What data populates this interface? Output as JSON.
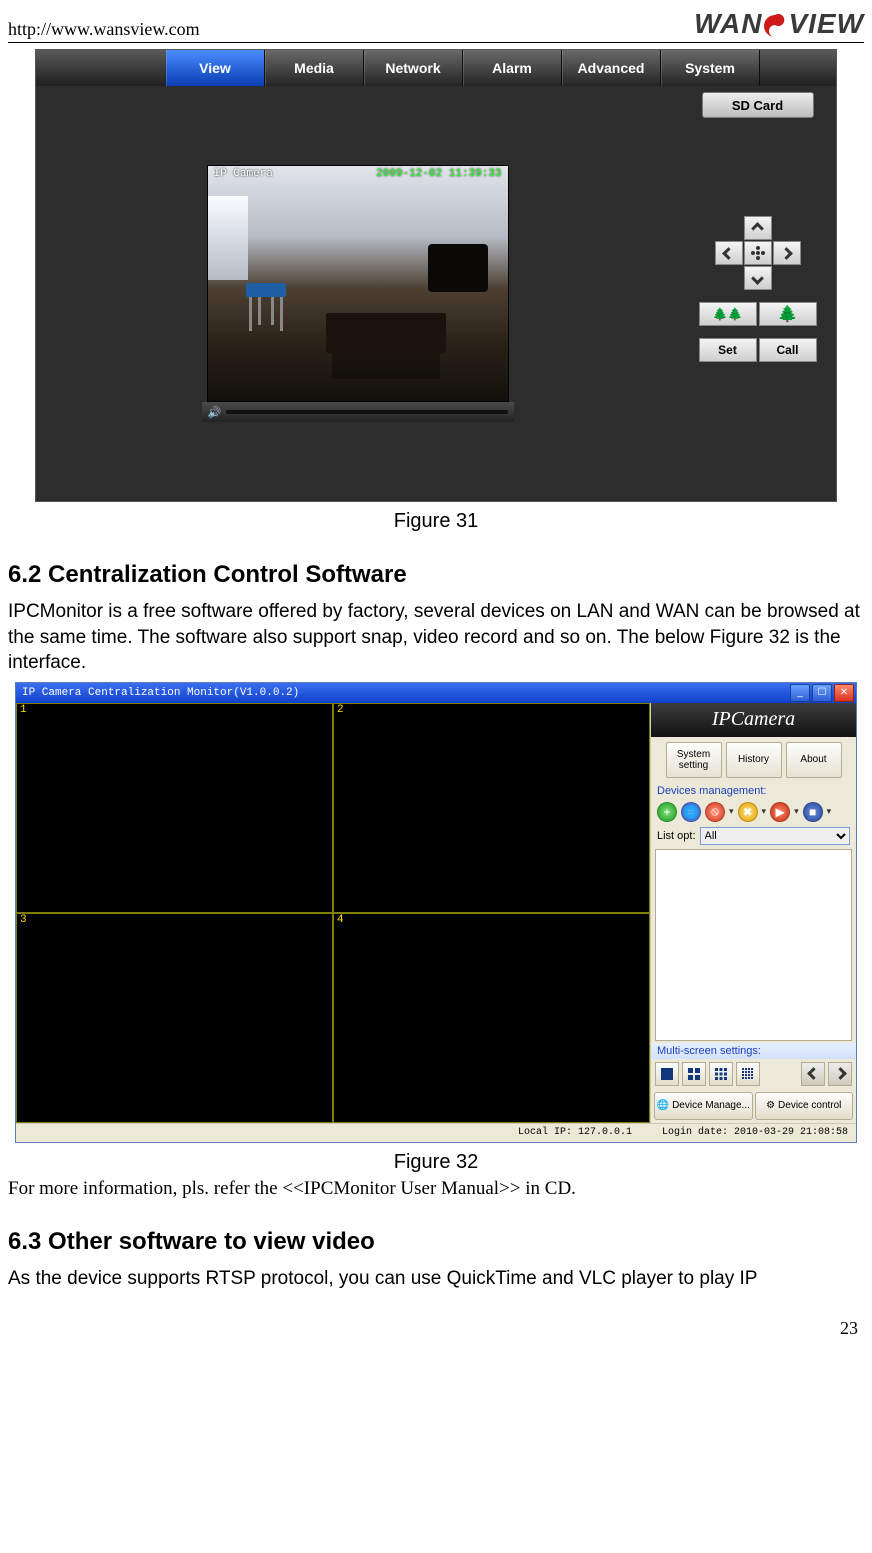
{
  "header": {
    "url": "http://www.wansview.com",
    "logo_pre": "WAN",
    "logo_s": "S",
    "logo_post": "VIEW"
  },
  "fig31": {
    "tabs": [
      "View",
      "Media",
      "Network",
      "Alarm",
      "Advanced",
      "System"
    ],
    "sd_button": "SD Card",
    "osd_name": "IP Camera",
    "osd_time": "2009-12-02 11:39:33",
    "set": "Set",
    "call": "Call",
    "caption": "Figure 31"
  },
  "sec62": {
    "heading": "6.2  Centralization Control Software",
    "para": "IPCMonitor is a free software offered by factory, several devices on LAN and WAN can be browsed at the same time. The software also support snap, video record and so on. The below Figure 32 is the interface."
  },
  "fig32": {
    "title": "IP Camera Centralization Monitor(V1.0.0.2)",
    "side_logo": "IPCamera",
    "buttons": [
      "System setting",
      "History",
      "About"
    ],
    "devices_label": "Devices management:",
    "listopt_label": "List opt:",
    "listopt_value": "All",
    "multi_label": "Multi-screen settings:",
    "bottom_tabs": [
      "Device Manage...",
      "Device control"
    ],
    "status_ip": "Local IP: 127.0.0.1",
    "status_date": "Login date: 2010-03-29 21:08:58",
    "cells": [
      "1",
      "2",
      "3",
      "4"
    ],
    "caption": "Figure 32",
    "note": "For more information, pls. refer the <<IPCMonitor User Manual>> in CD."
  },
  "sec63": {
    "heading": "6.3  Other software to view video",
    "para": "As the device supports RTSP protocol, you can use QuickTime and VLC player to play IP"
  },
  "page_number": "23"
}
